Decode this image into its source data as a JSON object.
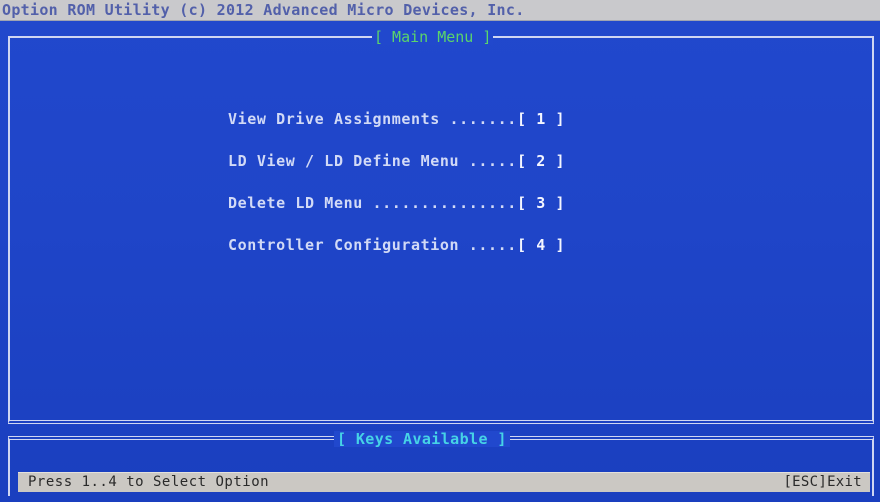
{
  "title_bar": {
    "text": "Option ROM Utility (c) 2012 Advanced Micro Devices, Inc."
  },
  "main_menu": {
    "title": "[ Main Menu ]",
    "items": [
      {
        "label": "View Drive Assignments .......",
        "key": "[ 1 ]"
      },
      {
        "label": "LD View / LD Define Menu .....",
        "key": "[ 2 ]"
      },
      {
        "label": "Delete LD Menu ...............",
        "key": "[ 3 ]"
      },
      {
        "label": "Controller Configuration .....",
        "key": "[ 4 ]"
      }
    ]
  },
  "keys_panel": {
    "title": "[ Keys Available ]",
    "hint_left": "Press 1..4 to Select Option",
    "hint_right": "[ESC]Exit"
  },
  "colors": {
    "background": "#1f45c8",
    "title_bar": "#c9c9cc",
    "menu_text": "#d2daf6",
    "panel_title_green": "#5bd56a",
    "panel_title_cyan": "#46d3e6"
  }
}
